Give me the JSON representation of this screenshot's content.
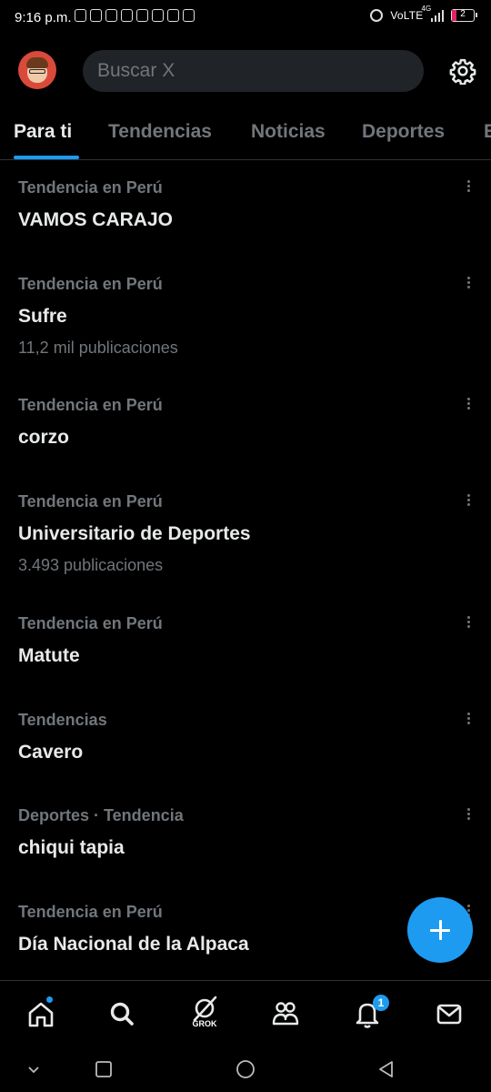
{
  "status_bar": {
    "time": "9:16 p.m.",
    "network": "VoLTE",
    "network_type": "4G",
    "battery": "2"
  },
  "header": {
    "search_placeholder": "Buscar X",
    "avatar": "user-avatar",
    "settings_icon": "gear-icon"
  },
  "tabs": [
    {
      "label": "Para ti",
      "active": true
    },
    {
      "label": "Tendencias",
      "active": false
    },
    {
      "label": "Noticias",
      "active": false
    },
    {
      "label": "Deportes",
      "active": false
    },
    {
      "label": "E",
      "active": false
    }
  ],
  "trends": [
    {
      "meta": "Tendencia en Perú",
      "title": "VAMOS CARAJO",
      "count": ""
    },
    {
      "meta": "Tendencia en Perú",
      "title": "Sufre",
      "count": "11,2 mil publicaciones"
    },
    {
      "meta": "Tendencia en Perú",
      "title": "corzo",
      "count": ""
    },
    {
      "meta": "Tendencia en Perú",
      "title": "Universitario de Deportes",
      "count": "3.493 publicaciones"
    },
    {
      "meta": "Tendencia en Perú",
      "title": "Matute",
      "count": ""
    },
    {
      "meta": "Tendencias",
      "title": "Cavero",
      "count": ""
    },
    {
      "meta": "Deportes · Tendencia",
      "title": "chiqui tapia",
      "count": ""
    },
    {
      "meta": "Tendencia en Perú",
      "title": "Día Nacional de la Alpaca",
      "count": ""
    }
  ],
  "bottom_nav": {
    "items": [
      "home-icon",
      "search-icon",
      "grok-icon",
      "communities-icon",
      "notifications-icon",
      "messages-icon"
    ],
    "grok_label": "GROK",
    "notification_count": "1"
  },
  "colors": {
    "accent": "#1d9bf0",
    "background": "#000000",
    "secondary_text": "#71767b",
    "primary_text": "#e7e9ea"
  }
}
